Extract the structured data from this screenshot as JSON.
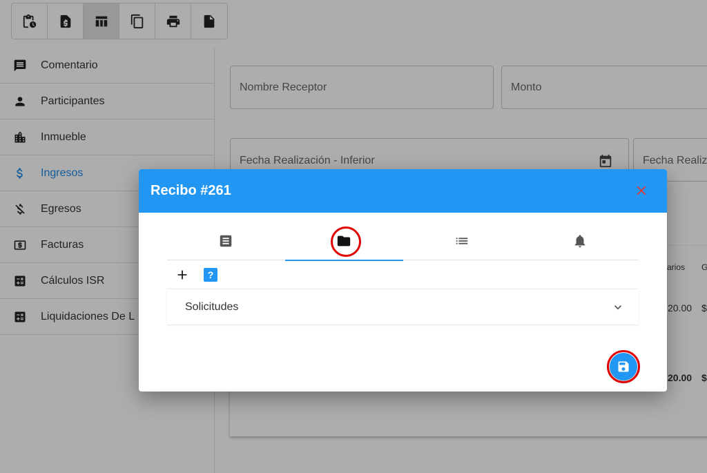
{
  "toolbar": {
    "buttons": [
      {
        "icon": "clipboard-clock-icon"
      },
      {
        "icon": "dollar-file-icon"
      },
      {
        "icon": "table-icon",
        "active": true
      },
      {
        "icon": "copy-icon"
      },
      {
        "icon": "print-icon"
      },
      {
        "icon": "file-icon"
      }
    ]
  },
  "sidebar": {
    "items": [
      {
        "label": "Comentario",
        "icon": "comment-icon"
      },
      {
        "label": "Participantes",
        "icon": "person-icon"
      },
      {
        "label": "Inmueble",
        "icon": "building-icon"
      },
      {
        "label": "Ingresos",
        "icon": "dollar-icon",
        "active": true
      },
      {
        "label": "Egresos",
        "icon": "money-off-icon"
      },
      {
        "label": "Facturas",
        "icon": "bill-icon"
      },
      {
        "label": "Cálculos ISR",
        "icon": "calculator-icon"
      },
      {
        "label": "Liquidaciones De L",
        "icon": "calculator-icon"
      }
    ]
  },
  "main": {
    "fields": {
      "nombre_receptor": "Nombre Receptor",
      "monto": "Monto",
      "fecha_inferior": "Fecha Realización - Inferior",
      "fecha_superior": "Fecha Realiz"
    },
    "table_peek": {
      "header_a": "arios",
      "header_b": "G",
      "row_value": "20.00",
      "row_currency": "$",
      "total_value": "20.00",
      "total_currency": "$"
    }
  },
  "dialog": {
    "title": "Recibo #261",
    "tabs": [
      {
        "icon": "document-list-icon"
      },
      {
        "icon": "folder-icon",
        "active": true
      },
      {
        "icon": "list-icon"
      },
      {
        "icon": "bell-icon"
      }
    ],
    "help_label": "?",
    "panel_label": "Solicitudes"
  },
  "colors": {
    "primary": "#2196f3",
    "close": "#e53935",
    "highlight_ring": "#e00000"
  }
}
